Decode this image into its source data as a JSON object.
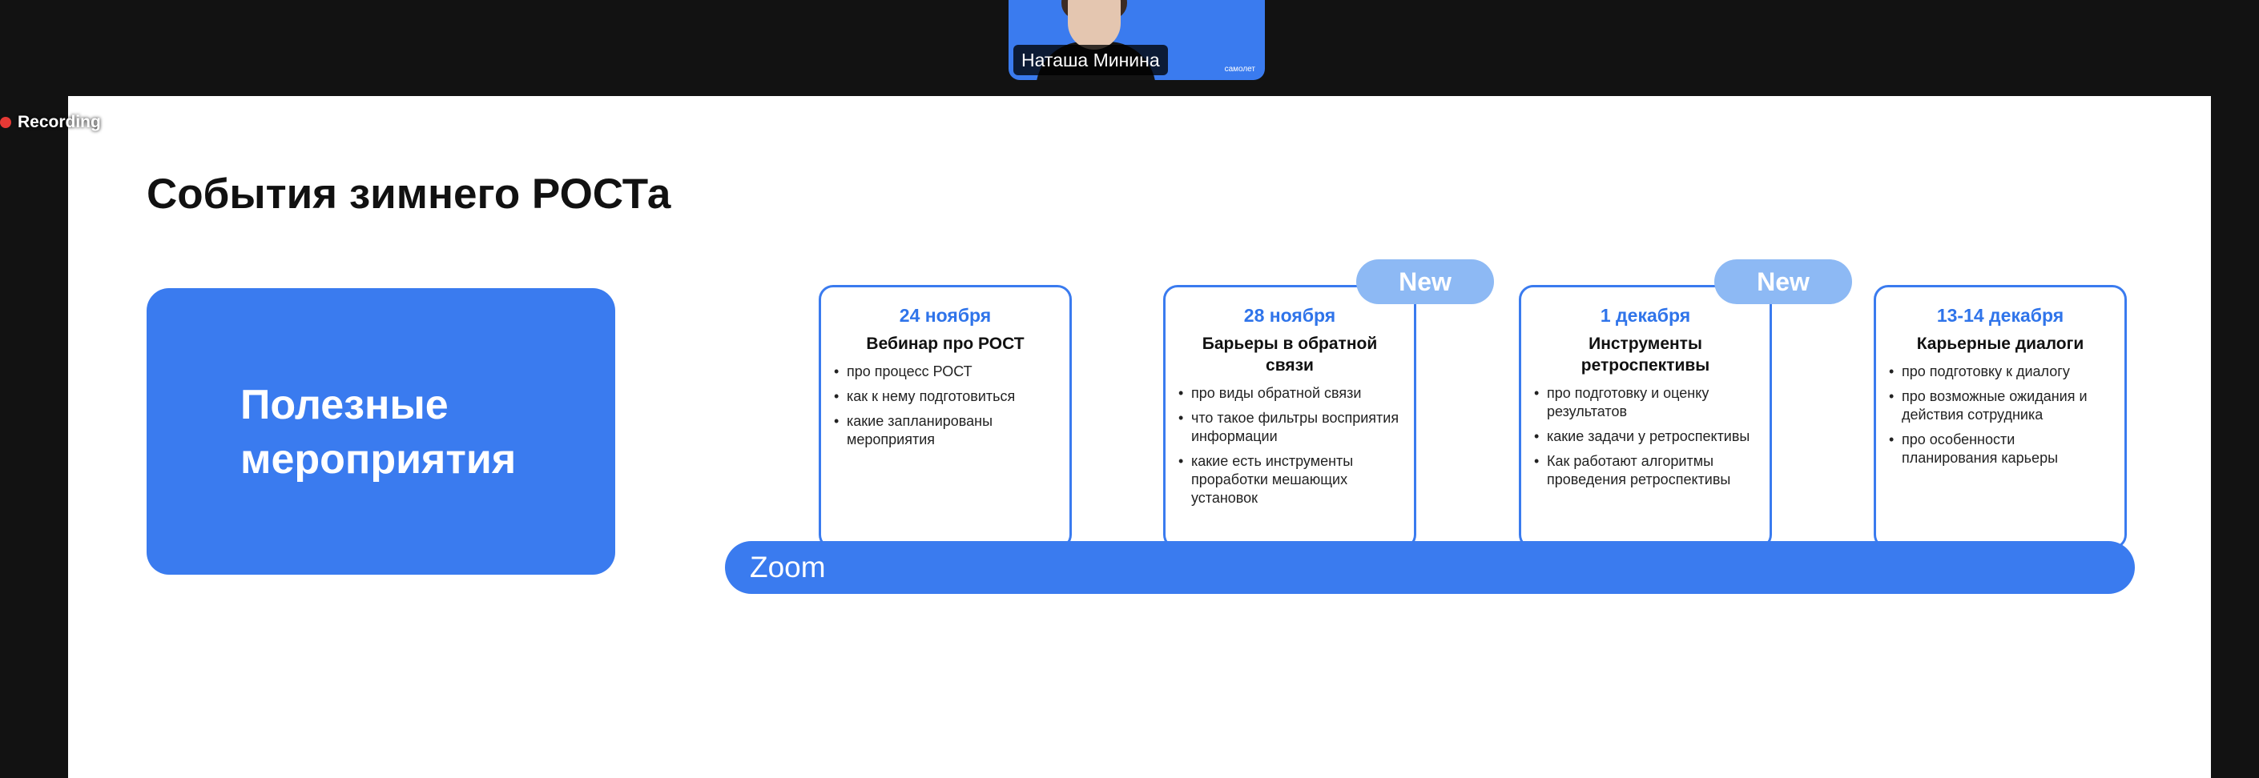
{
  "meeting": {
    "participant_name": "Наташа Минина",
    "brand": "самолет",
    "recording_label": "Recording"
  },
  "slide": {
    "title": "События зимнего РОСТа",
    "left_box": "Полезные мероприятия",
    "new_label": "New",
    "zoom_label": "Zoom",
    "accent_color": "#3a7bef",
    "events": [
      {
        "date": "24 ноября",
        "title": "Вебинар про РОСТ",
        "items": [
          "про процесс РОСТ",
          "как к нему подготовиться",
          "какие запланированы мероприятия"
        ]
      },
      {
        "date": "28 ноября",
        "title": "Барьеры в обратной связи",
        "items": [
          "про виды обратной связи",
          "что такое фильтры восприятия информации",
          "какие есть инструменты проработки мешающих установок"
        ]
      },
      {
        "date": "1 декабря",
        "title": "Инструменты ретроспективы",
        "items": [
          "про подготовку и оценку результатов",
          "какие задачи у ретроспективы",
          "Как работают алгоритмы проведения ретроспективы"
        ]
      },
      {
        "date": "13-14 декабря",
        "title": "Карьерные диалоги",
        "items": [
          "про подготовку к диалогу",
          "про возможные ожидания и действия сотрудника",
          "про особенности планирования карьеры"
        ]
      }
    ]
  }
}
